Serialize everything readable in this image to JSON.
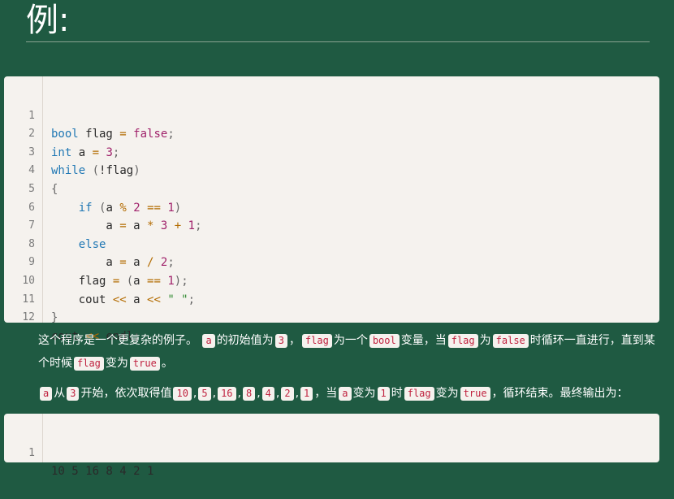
{
  "heading": "例:",
  "code_block": {
    "line_numbers": [
      "1",
      "2",
      "3",
      "4",
      "5",
      "6",
      "7",
      "8",
      "9",
      "10",
      "11",
      "12"
    ]
  },
  "paragraph1": {
    "s1": "这个程序是一个更复杂的例子。",
    "c1": "a",
    "s2": "的初始值为",
    "c2": "3",
    "s3": "，",
    "c3": "flag",
    "s4": "为一个",
    "c4": "bool",
    "s5": "变量，当",
    "c5": "flag",
    "s6": "为",
    "c6": "false",
    "s7": "时循环一直进行，直到某个时候",
    "c7": "flag",
    "s8": "变为",
    "c8": "true",
    "s9": "。"
  },
  "paragraph2": {
    "c1": "a",
    "s1": "从",
    "c2": "3",
    "s2": "开始，依次取得值",
    "values": [
      "10",
      "5",
      "16",
      "8",
      "4",
      "2",
      "1"
    ],
    "s3": "，当",
    "c3": "a",
    "s4": "变为",
    "c4": "1",
    "s5": "时",
    "c5": "flag",
    "s6": "变为",
    "c6": "true",
    "s7": "，循环结束。最终输出为："
  },
  "output_block": {
    "line_number": "1",
    "text": "10 5 16 8 4 2 1"
  }
}
